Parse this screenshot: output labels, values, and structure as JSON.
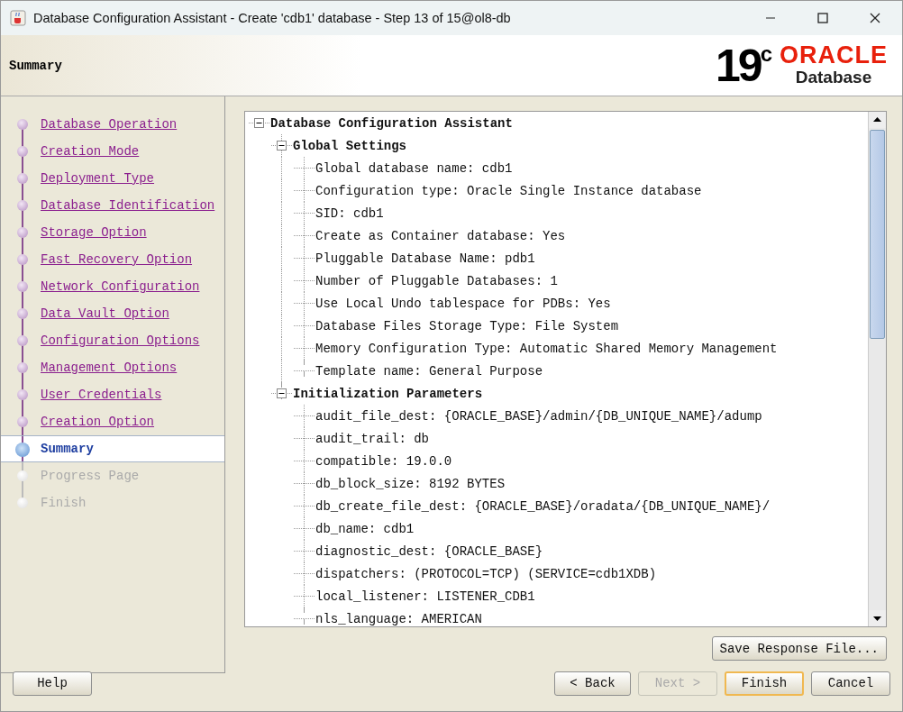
{
  "window": {
    "title": "Database Configuration Assistant - Create 'cdb1' database - Step 13 of 15@ol8-db"
  },
  "header": {
    "title": "Summary",
    "logo_version": "19",
    "logo_superscript": "c",
    "logo_brand": "ORACLE",
    "logo_product": "Database"
  },
  "steps": [
    {
      "label": "Database Operation",
      "selected": false,
      "disabled": false
    },
    {
      "label": "Creation Mode",
      "selected": false,
      "disabled": false
    },
    {
      "label": "Deployment Type",
      "selected": false,
      "disabled": false
    },
    {
      "label": "Database Identification",
      "selected": false,
      "disabled": false
    },
    {
      "label": "Storage Option",
      "selected": false,
      "disabled": false
    },
    {
      "label": "Fast Recovery Option",
      "selected": false,
      "disabled": false
    },
    {
      "label": "Network Configuration",
      "selected": false,
      "disabled": false
    },
    {
      "label": "Data Vault Option",
      "selected": false,
      "disabled": false
    },
    {
      "label": "Configuration Options",
      "selected": false,
      "disabled": false
    },
    {
      "label": "Management Options",
      "selected": false,
      "disabled": false
    },
    {
      "label": "User Credentials",
      "selected": false,
      "disabled": false
    },
    {
      "label": "Creation Option",
      "selected": false,
      "disabled": false
    },
    {
      "label": "Summary",
      "selected": true,
      "disabled": false
    },
    {
      "label": "Progress Page",
      "selected": false,
      "disabled": true
    },
    {
      "label": "Finish",
      "selected": false,
      "disabled": true
    }
  ],
  "tree": [
    {
      "label": "Database Configuration Assistant",
      "expanded": true,
      "children": [
        {
          "label": "Global Settings",
          "expanded": true,
          "children": [
            {
              "label": "Global database name: cdb1"
            },
            {
              "label": "Configuration type: Oracle Single Instance database"
            },
            {
              "label": "SID: cdb1"
            },
            {
              "label": "Create as Container database: Yes"
            },
            {
              "label": "Pluggable Database Name: pdb1"
            },
            {
              "label": "Number of Pluggable Databases: 1"
            },
            {
              "label": "Use Local Undo tablespace for PDBs: Yes"
            },
            {
              "label": "Database Files Storage Type: File System"
            },
            {
              "label": "Memory Configuration Type: Automatic Shared Memory Management"
            },
            {
              "label": "Template name: General Purpose"
            }
          ]
        },
        {
          "label": "Initialization Parameters",
          "expanded": true,
          "children": [
            {
              "label": "audit_file_dest: {ORACLE_BASE}/admin/{DB_UNIQUE_NAME}/adump"
            },
            {
              "label": "audit_trail: db"
            },
            {
              "label": "compatible: 19.0.0"
            },
            {
              "label": "db_block_size: 8192 BYTES"
            },
            {
              "label": "db_create_file_dest: {ORACLE_BASE}/oradata/{DB_UNIQUE_NAME}/"
            },
            {
              "label": "db_name: cdb1"
            },
            {
              "label": "diagnostic_dest: {ORACLE_BASE}"
            },
            {
              "label": "dispatchers: (PROTOCOL=TCP) (SERVICE=cdb1XDB)"
            },
            {
              "label": "local_listener: LISTENER_CDB1"
            },
            {
              "label": "nls_language: AMERICAN"
            }
          ]
        }
      ]
    }
  ],
  "save_button": {
    "label": "Save Response File...",
    "disabled": false
  },
  "buttons": [
    {
      "label": "Help",
      "disabled": false,
      "default": false
    },
    {
      "label": "< Back",
      "disabled": false,
      "default": false
    },
    {
      "label": "Next >",
      "disabled": true,
      "default": false
    },
    {
      "label": "Finish",
      "disabled": false,
      "default": true
    },
    {
      "label": "Cancel",
      "disabled": false,
      "default": false
    }
  ]
}
